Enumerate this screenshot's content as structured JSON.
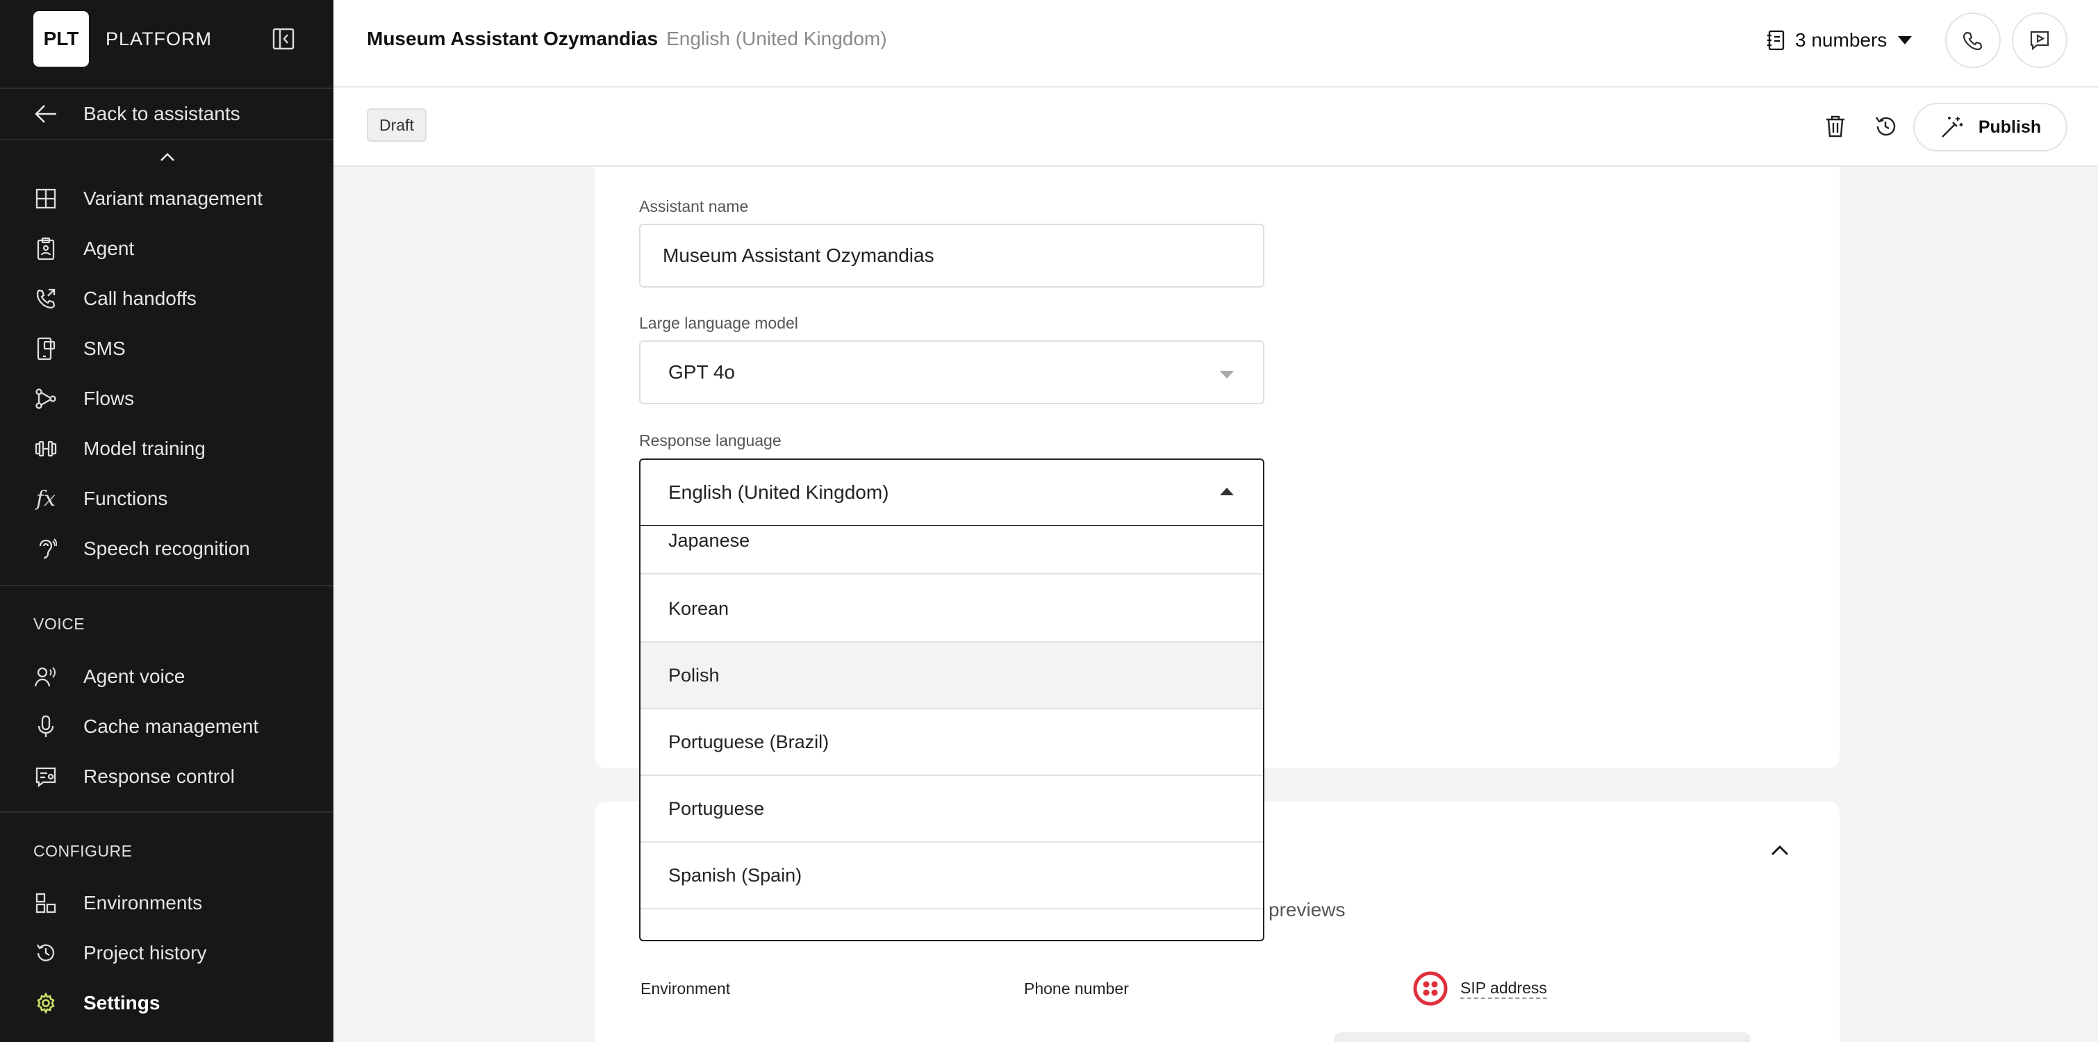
{
  "sidebar": {
    "logo_text": "PLT",
    "brand_name": "PLATFORM",
    "back_label": "Back to assistants",
    "items": [
      {
        "label": "Variant management",
        "icon": "grid-icon"
      },
      {
        "label": "Agent",
        "icon": "clipboard-icon"
      },
      {
        "label": "Call handoffs",
        "icon": "phone-forward-icon"
      },
      {
        "label": "SMS",
        "icon": "sms-icon"
      },
      {
        "label": "Flows",
        "icon": "flow-icon"
      },
      {
        "label": "Model training",
        "icon": "dumbbell-icon"
      },
      {
        "label": "Functions",
        "icon": "function-icon"
      },
      {
        "label": "Speech recognition",
        "icon": "ear-icon"
      }
    ],
    "voice_section": "VOICE",
    "voice_items": [
      {
        "label": "Agent voice",
        "icon": "voice-user-icon"
      },
      {
        "label": "Cache management",
        "icon": "microphone-icon"
      },
      {
        "label": "Response control",
        "icon": "response-icon"
      }
    ],
    "configure_section": "CONFIGURE",
    "configure_items": [
      {
        "label": "Environments",
        "icon": "environments-icon"
      },
      {
        "label": "Project history",
        "icon": "history-icon"
      },
      {
        "label": "Settings",
        "icon": "gear-icon",
        "active": true
      }
    ]
  },
  "header": {
    "title": "Museum Assistant Ozymandias",
    "language": "English (United Kingdom)",
    "numbers_label": "3 numbers"
  },
  "toolbar": {
    "status": "Draft",
    "publish_label": "Publish"
  },
  "form": {
    "assistant_name_label": "Assistant name",
    "assistant_name_value": "Museum Assistant Ozymandias",
    "llm_label": "Large language model",
    "llm_value": "GPT 4o",
    "response_language_label": "Response language",
    "response_language_value": "English (United Kingdom)",
    "language_options": [
      "Japanese",
      "Korean",
      "Polish",
      "Portuguese (Brazil)",
      "Portuguese",
      "Spanish (Spain)"
    ],
    "highlighted_option": "Polish"
  },
  "deployment": {
    "previews_text": "previews",
    "columns": [
      "Environment",
      "Phone number"
    ],
    "sip_label": "SIP address"
  },
  "colors": {
    "sidebar_bg": "#171717",
    "settings_icon": "#c9e265",
    "sip_icon": "#e0303c"
  }
}
